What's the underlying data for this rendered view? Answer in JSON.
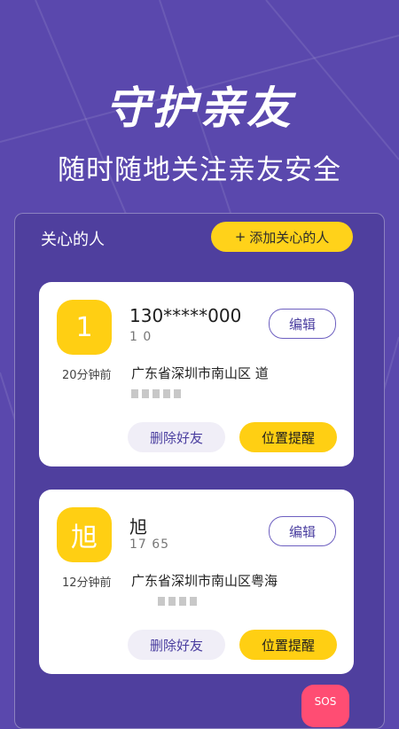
{
  "hero": {
    "title": "守护亲友",
    "subtitle": "随时随地关注亲友安全"
  },
  "section": {
    "title": "关心的人",
    "add_button": "添加关心的人",
    "add_icon": "+"
  },
  "contacts": [
    {
      "avatar_text": "1",
      "name": "130*****000",
      "phone_visible": "1           0",
      "time": "20分钟前",
      "address": "广东省深圳市南山区    道",
      "edit_label": "编辑",
      "delete_label": "删除好友",
      "locate_label": "位置提醒"
    },
    {
      "avatar_text": "旭",
      "name": "旭",
      "phone_visible": "17          65",
      "time": "12分钟前",
      "address": "广东省深圳市南山区粤海",
      "edit_label": "编辑",
      "delete_label": "删除好友",
      "locate_label": "位置提醒"
    }
  ],
  "sos": {
    "label": "SOS"
  },
  "colors": {
    "background": "#5a48ad",
    "accent_yellow": "#ffcf13",
    "sos_red": "#ff4d73"
  }
}
